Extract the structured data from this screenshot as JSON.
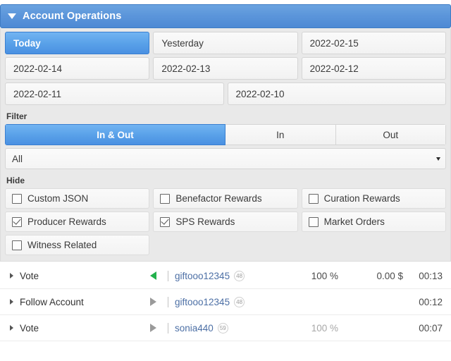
{
  "header": {
    "title": "Account Operations",
    "collapse_icon": "triangle-down-icon"
  },
  "dates": [
    {
      "label": "Today",
      "active": true
    },
    {
      "label": "Yesterday",
      "active": false
    },
    {
      "label": "2022-02-15",
      "active": false
    },
    {
      "label": "2022-02-14",
      "active": false
    },
    {
      "label": "2022-02-13",
      "active": false
    },
    {
      "label": "2022-02-12",
      "active": false
    },
    {
      "label": "2022-02-11",
      "active": false
    },
    {
      "label": "2022-02-10",
      "active": false
    }
  ],
  "filter": {
    "label": "Filter",
    "segments": [
      {
        "label": "In & Out",
        "active": true
      },
      {
        "label": "In",
        "active": false
      },
      {
        "label": "Out",
        "active": false
      }
    ],
    "select": {
      "value": "All",
      "caret_icon": "chevron-down-icon"
    }
  },
  "hide": {
    "label": "Hide",
    "options": [
      {
        "label": "Custom JSON",
        "checked": false
      },
      {
        "label": "Benefactor Rewards",
        "checked": false
      },
      {
        "label": "Curation Rewards",
        "checked": false
      },
      {
        "label": "Producer Rewards",
        "checked": true
      },
      {
        "label": "SPS Rewards",
        "checked": true
      },
      {
        "label": "Market Orders",
        "checked": false
      },
      {
        "label": "Witness Related",
        "checked": false
      }
    ]
  },
  "operations": [
    {
      "name": "Vote",
      "direction": "in",
      "account": "giftooo12345",
      "reputation": "48",
      "percent": "100 %",
      "amount": "0.00 $",
      "time": "00:13"
    },
    {
      "name": "Follow Account",
      "direction": "out",
      "account": "giftooo12345",
      "reputation": "48",
      "percent": "",
      "amount": "",
      "time": "00:12"
    },
    {
      "name": "Vote",
      "direction": "out",
      "account": "sonia440",
      "reputation": "59",
      "percent": "100 %",
      "amount": "",
      "time": "00:07"
    }
  ],
  "colors": {
    "accent_blue": "#4a90e2",
    "header_blue": "#5b95da",
    "incoming_green": "#22b14c",
    "outgoing_gray": "#9a9a9a",
    "link_blue": "#4c6fa5",
    "panel_gray": "#e9e9e9"
  }
}
